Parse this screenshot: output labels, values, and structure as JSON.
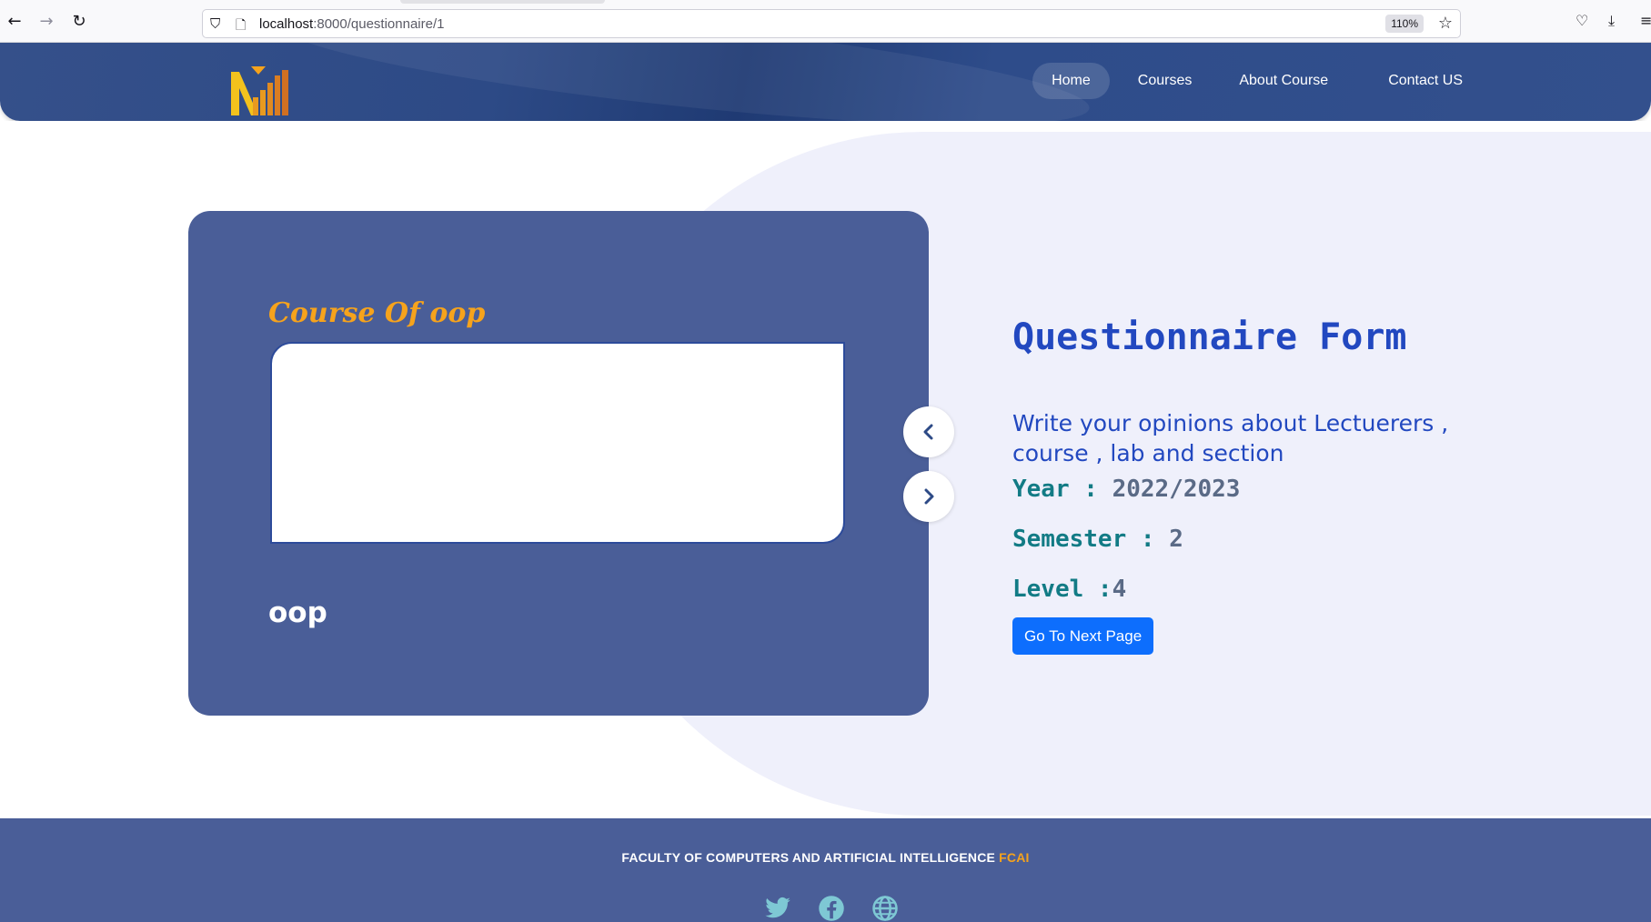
{
  "browser": {
    "url_host": "localhost",
    "url_path": ":8000/questionnaire/1",
    "zoom": "110%"
  },
  "navbar": {
    "links": [
      {
        "label": "Home",
        "active": true
      },
      {
        "label": "Courses"
      },
      {
        "label": "About Course"
      },
      {
        "label": "Contact US"
      }
    ]
  },
  "card": {
    "title": "Course Of oop",
    "name": "oop"
  },
  "form": {
    "title": "Questionnaire Form",
    "description": "Write your opinions about Lectuerers , course , lab and section",
    "year_label": "Year : ",
    "year_value": "2022/2023",
    "semester_label": "Semester : ",
    "semester_value": "2",
    "level_label": "Level :",
    "level_value": "4",
    "next_button": "Go To Next Page"
  },
  "footer": {
    "text": "FACULTY OF COMPUTERS AND ARTIFICIAL INTELLIGENCE ",
    "accent": "FCAI",
    "social_icons": [
      "twitter-icon",
      "facebook-icon",
      "globe-icon"
    ]
  },
  "colors": {
    "nav_bg": "#2d4a86",
    "card_bg": "#4a5e98",
    "accent_orange": "#f6a31c",
    "title_blue": "#2248c0",
    "info_teal": "#127b85",
    "button_blue": "#0d6efd"
  }
}
